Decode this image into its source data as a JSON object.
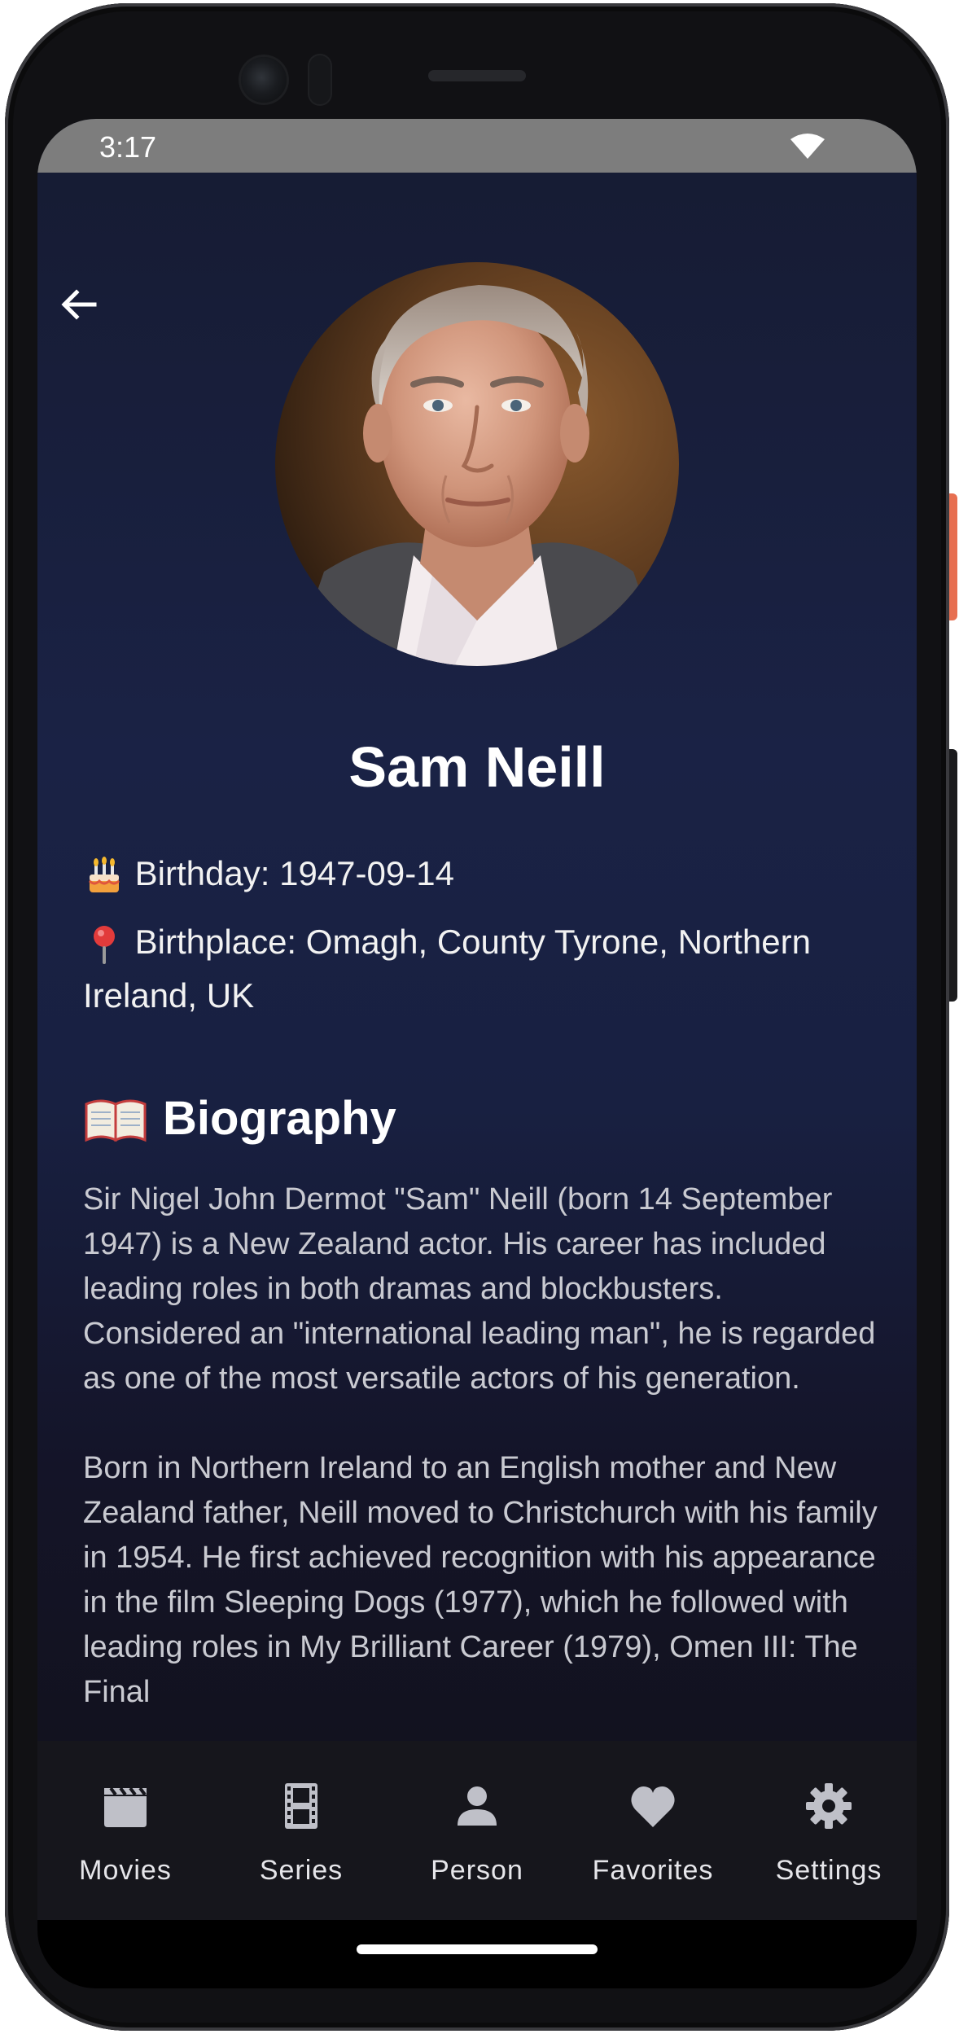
{
  "status_bar": {
    "time": "3:17"
  },
  "person": {
    "name": "Sam Neill",
    "birthday_label": "Birthday: 1947-09-14",
    "birthplace_label": "Birthplace: Omagh, County Tyrone, Northern Ireland, UK"
  },
  "biography": {
    "heading": "Biography",
    "paragraph_1": "Sir Nigel John Dermot \"Sam\" Neill (born 14 September 1947) is a New Zealand actor. His career has included leading roles in both dramas and blockbusters. Considered an \"international leading man\", he is regarded as one of the most versatile actors of his generation.",
    "paragraph_2": "Born in Northern Ireland to an English mother and New Zealand father, Neill moved to Christchurch with his family in 1954. He first achieved recognition with his appearance in the film Sleeping Dogs (1977), which he followed with leading roles in My Brilliant Career (1979), Omen III: The Final"
  },
  "bottom_nav": {
    "items": [
      {
        "label": "Movies",
        "icon": "movie-clapper-icon"
      },
      {
        "label": "Series",
        "icon": "film-strip-icon"
      },
      {
        "label": "Person",
        "icon": "person-icon"
      },
      {
        "label": "Favorites",
        "icon": "heart-icon"
      },
      {
        "label": "Settings",
        "icon": "gear-icon"
      }
    ]
  },
  "colors": {
    "background_top": "#161b32",
    "background_mid": "#1a2245",
    "background_bottom": "#111119",
    "nav_background": "#16161c",
    "status_bar": "#7d7d7d",
    "side_button": "#e76f51"
  }
}
